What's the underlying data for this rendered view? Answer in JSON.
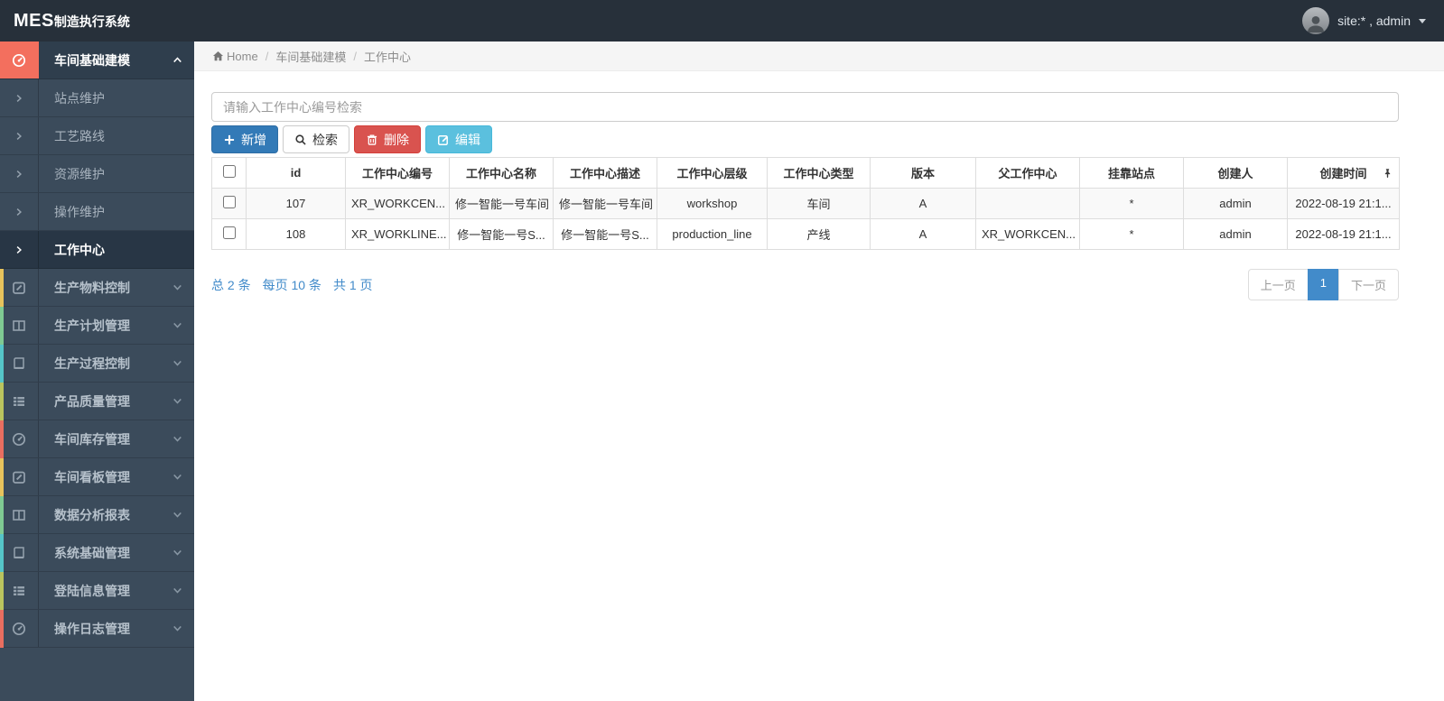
{
  "navbar": {
    "brand_bold": "MES",
    "brand_rest": "制造执行系统",
    "user_label": "site:* , admin"
  },
  "breadcrumb": {
    "home": "Home",
    "separator": "/",
    "items": [
      "车间基础建模",
      "工作中心"
    ]
  },
  "sidebar": {
    "groups": [
      {
        "label": "车间基础建模",
        "icon": "dashboard-icon",
        "accent": "#f36f5e",
        "expanded": true,
        "children": [
          "站点维护",
          "工艺路线",
          "资源维护",
          "操作维护",
          "工作中心"
        ],
        "active_child": "工作中心"
      },
      {
        "label": "生产物料控制",
        "icon": "edit-square-icon",
        "accent": "#e7c35c"
      },
      {
        "label": "生产计划管理",
        "icon": "columns-icon",
        "accent": "#7fca92"
      },
      {
        "label": "生产过程控制",
        "icon": "book-icon",
        "accent": "#55c5c8"
      },
      {
        "label": "产品质量管理",
        "icon": "list-icon",
        "accent": "#bac45e"
      },
      {
        "label": "车间库存管理",
        "icon": "dashboard-icon",
        "accent": "#e96e60"
      },
      {
        "label": "车间看板管理",
        "icon": "edit-square-icon",
        "accent": "#e7c35c"
      },
      {
        "label": "数据分析报表",
        "icon": "columns-icon",
        "accent": "#7fca92"
      },
      {
        "label": "系统基础管理",
        "icon": "book-icon",
        "accent": "#55c5c8"
      },
      {
        "label": "登陆信息管理",
        "icon": "list-icon",
        "accent": "#bac45e"
      },
      {
        "label": "操作日志管理",
        "icon": "dashboard-icon",
        "accent": "#e96e60"
      }
    ]
  },
  "toolbar": {
    "search_placeholder": "请输入工作中心编号检索",
    "add_label": "新增",
    "search_label": "检索",
    "delete_label": "删除",
    "edit_label": "编辑"
  },
  "table": {
    "columns": [
      "id",
      "工作中心编号",
      "工作中心名称",
      "工作中心描述",
      "工作中心层级",
      "工作中心类型",
      "版本",
      "父工作中心",
      "挂靠站点",
      "创建人",
      "创建时间"
    ],
    "rows": [
      [
        "107",
        "XR_WORKCEN...",
        "修一智能一号车间",
        "修一智能一号车间",
        "workshop",
        "车间",
        "A",
        "",
        "*",
        "admin",
        "2022-08-19 21:1..."
      ],
      [
        "108",
        "XR_WORKLINE...",
        "修一智能一号S...",
        "修一智能一号S...",
        "production_line",
        "产线",
        "A",
        "XR_WORKCEN...",
        "*",
        "admin",
        "2022-08-19 21:1..."
      ]
    ]
  },
  "pagination": {
    "summary_total": "总 2 条",
    "summary_per_page": "每页 10 条",
    "summary_pages": "共 1 页",
    "prev": "上一页",
    "current_page": "1",
    "next": "下一页"
  },
  "colors": {
    "navbar_bg": "#27303a",
    "sidebar_bg": "#3b4b5b",
    "active_group_accent": "#f36f5e",
    "primary_button": "#337ab7",
    "danger_button": "#d9534f",
    "info_button": "#5bc0de",
    "pagination_active": "#428bca",
    "link_blue": "#428bca"
  }
}
